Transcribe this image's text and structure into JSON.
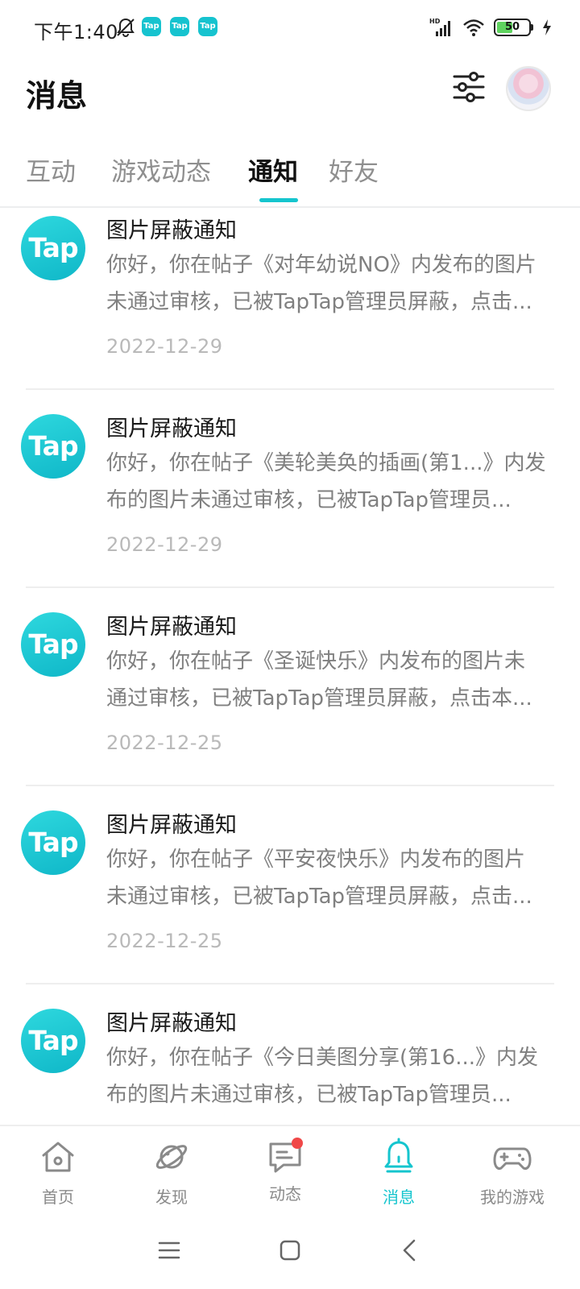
{
  "status_bar": {
    "time": "下午1:40",
    "app_icon_label": "Tap",
    "network_label": "HD",
    "battery_level": "50",
    "battery_fraction": 0.5
  },
  "header": {
    "title": "消息"
  },
  "tabs": [
    {
      "label": "互动",
      "active": false
    },
    {
      "label": "游戏动态",
      "active": false
    },
    {
      "label": "通知",
      "active": true
    },
    {
      "label": "好友",
      "active": false
    }
  ],
  "notifications": [
    {
      "avatar_label": "Tap",
      "title": "图片屏蔽通知",
      "body_line1": "你好，你在帖子《对年幼说NO》内发布的图片",
      "body_line2": "未通过审核，已被TapTap管理员屏蔽，点击...",
      "date": "2022-12-29"
    },
    {
      "avatar_label": "Tap",
      "title": "图片屏蔽通知",
      "body_line1": "你好，你在帖子《美轮美奂的插画(第1...》内发",
      "body_line2": "布的图片未通过审核，已被TapTap管理员...",
      "date": "2022-12-29"
    },
    {
      "avatar_label": "Tap",
      "title": "图片屏蔽通知",
      "body_line1": "你好，你在帖子《圣诞快乐》内发布的图片未",
      "body_line2": "通过审核，已被TapTap管理员屏蔽，点击本...",
      "date": "2022-12-25"
    },
    {
      "avatar_label": "Tap",
      "title": "图片屏蔽通知",
      "body_line1": "你好，你在帖子《平安夜快乐》内发布的图片",
      "body_line2": "未通过审核，已被TapTap管理员屏蔽，点击...",
      "date": "2022-12-25"
    },
    {
      "avatar_label": "Tap",
      "title": "图片屏蔽通知",
      "body_line1": "你好，你在帖子《今日美图分享(第16...》内发",
      "body_line2": "布的图片未通过审核，已被TapTap管理员...",
      "date": ""
    }
  ],
  "bottom_nav": [
    {
      "label": "首页",
      "icon": "home-icon",
      "active": false
    },
    {
      "label": "发现",
      "icon": "planet-icon",
      "active": false
    },
    {
      "label": "动态",
      "icon": "chat-icon",
      "active": false,
      "badge": true
    },
    {
      "label": "消息",
      "icon": "bell-icon",
      "active": true
    },
    {
      "label": "我的游戏",
      "icon": "gamepad-icon",
      "active": false
    }
  ],
  "colors": {
    "accent": "#15c5ce",
    "badge": "#f04848",
    "muted_text": "#808080",
    "date_text": "#b9b9b9"
  }
}
